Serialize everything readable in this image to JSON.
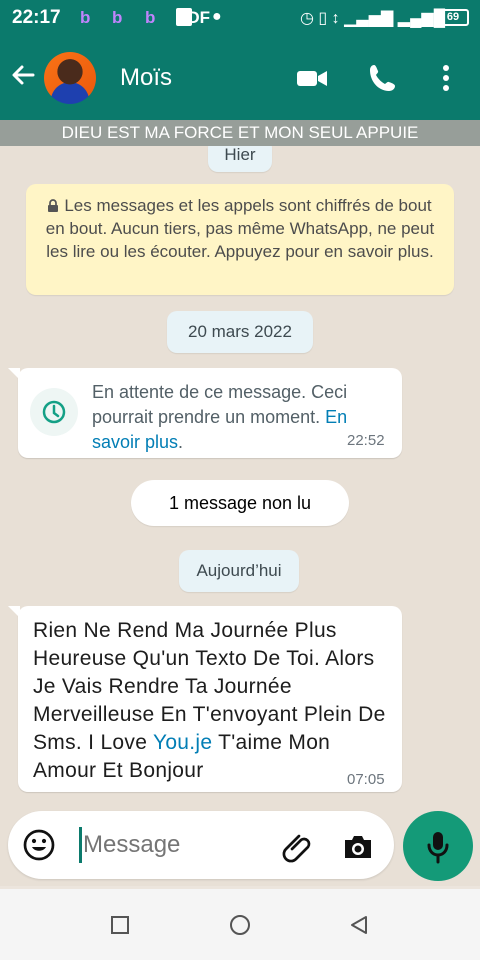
{
  "status": {
    "time": "22:17",
    "apps": [
      "b",
      "b",
      "b",
      "PDF"
    ],
    "battery": "69",
    "icons": [
      "alarm-icon",
      "vibrate-icon",
      "signal-icon",
      "wifi-icon"
    ]
  },
  "header": {
    "contact_name": "Moïs",
    "banner": "DIEU EST MA FORCE ET MON SEUL APPUIE",
    "icons": [
      "back-arrow-icon",
      "video-icon",
      "phone-icon",
      "more-icon"
    ]
  },
  "chat": {
    "date_yesterday": "Hier",
    "encryption": "Les messages et les appels sont chiffrés de bout en bout. Aucun tiers, pas même WhatsApp, ne peut les lire ou les écouter. Appuyez pour en savoir plus.",
    "date_20_march": "20 mars 2022",
    "waiting_message": "En attente de ce message. Ceci pourrait prendre un moment.",
    "waiting_link": "En savoir plus",
    "waiting_period": ".",
    "waiting_time": "22:52",
    "unread": "1 message non lu",
    "date_today": "Aujourd’hui",
    "message_before_link": "Rien Ne Rend Ma Journée Plus Heureuse Qu'un Texto De Toi. Alors Je Vais Rendre Ta Journée Merveilleuse En T'envoyant Plein De Sms. I Love ",
    "message_link": "You.je",
    "message_after_link": " T'aime Mon Amour Et Bonjour",
    "message_time": "07:05"
  },
  "input": {
    "placeholder": "Message",
    "icons": [
      "emoji-icon",
      "attachment-icon",
      "camera-icon",
      "microphone-icon"
    ]
  },
  "navigation": {
    "icons": [
      "recent-apps-icon",
      "home-icon",
      "back-icon"
    ]
  },
  "colors": {
    "primary": "#0b7a6c",
    "accent": "#149a78",
    "chat_background": "#e8e0d6",
    "system_message": "#fff5c6",
    "link": "#027eb5"
  }
}
